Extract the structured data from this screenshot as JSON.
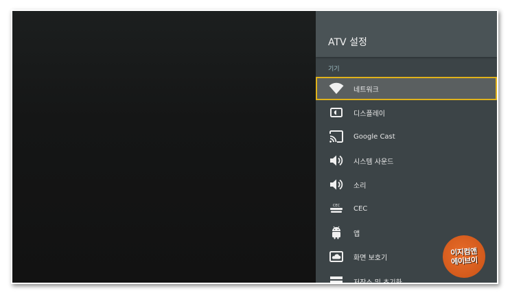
{
  "panel": {
    "title": "ATV 설정",
    "section_label": "기기"
  },
  "menu": {
    "items": [
      {
        "label": "네트워크",
        "icon": "wifi-icon",
        "selected": true
      },
      {
        "label": "디스플레이",
        "icon": "display-icon",
        "selected": false
      },
      {
        "label": "Google Cast",
        "icon": "cast-icon",
        "selected": false
      },
      {
        "label": "시스템 사운드",
        "icon": "speaker-icon",
        "selected": false
      },
      {
        "label": "소리",
        "icon": "speaker-icon",
        "selected": false
      },
      {
        "label": "CEC",
        "icon": "cec-icon",
        "selected": false
      },
      {
        "label": "앱",
        "icon": "android-icon",
        "selected": false
      },
      {
        "label": "화면 보호기",
        "icon": "screensaver-icon",
        "selected": false
      },
      {
        "label": "저장소 및 초기화",
        "icon": "storage-icon",
        "selected": false
      }
    ]
  },
  "watermark": {
    "line1": "이지컴앤",
    "line2": "에이브이"
  },
  "colors": {
    "panel_bg": "#3c4447",
    "header_bg": "#4a5356",
    "selection_border": "#e0b21a",
    "section_label": "#9fbfc4"
  }
}
